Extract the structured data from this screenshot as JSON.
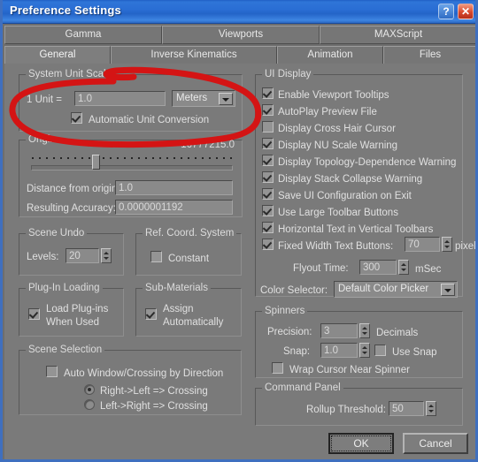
{
  "window": {
    "title": "Preference Settings",
    "help_button": "?",
    "close_button": "✕",
    "accent_titlebar": "#2a6ed4",
    "bg": "#7a7a7a",
    "annotation_color": "#d41414"
  },
  "tabs": {
    "top_row": [
      {
        "label": "Gamma",
        "active": false
      },
      {
        "label": "Viewports",
        "active": false
      },
      {
        "label": "MAXScript",
        "active": false
      }
    ],
    "bottom_row": [
      {
        "label": "General",
        "active": true
      },
      {
        "label": "Inverse Kinematics",
        "active": false
      },
      {
        "label": "Animation",
        "active": false
      },
      {
        "label": "Files",
        "active": false
      }
    ]
  },
  "system_unit_scale": {
    "group_title": "System Unit Scale",
    "unit_label": "1 Unit =",
    "unit_value": "1.0",
    "unit_type_selected": "Meters",
    "auto_conversion_label": "Automatic Unit Conversion",
    "auto_conversion_checked": true
  },
  "origin": {
    "group_title": "Origin",
    "max_value": "16777215.0",
    "distance_label": "Distance from origin:",
    "distance_value": "1.0",
    "accuracy_label": "Resulting Accuracy:",
    "accuracy_value": "0.0000001192"
  },
  "scene_undo": {
    "group_title": "Scene Undo",
    "levels_label": "Levels:",
    "levels_value": "20"
  },
  "ref_coord_system": {
    "group_title": "Ref. Coord. System",
    "constant_label": "Constant",
    "constant_checked": false
  },
  "plugin_loading": {
    "group_title": "Plug-In Loading",
    "load_label_line1": "Load Plug-ins",
    "load_label_line2": "When Used",
    "load_checked": true
  },
  "sub_materials": {
    "group_title": "Sub-Materials",
    "assign_label_line1": "Assign",
    "assign_label_line2": "Automatically",
    "assign_checked": true
  },
  "scene_selection": {
    "group_title": "Scene Selection",
    "auto_window_label": "Auto Window/Crossing by Direction",
    "auto_window_checked": false,
    "radio_right_left": "Right->Left => Crossing",
    "radio_left_right": "Left->Right => Crossing",
    "radio_selected": "right_left"
  },
  "ui_display": {
    "group_title": "UI Display",
    "checkboxes": [
      {
        "label": "Enable Viewport Tooltips",
        "checked": true
      },
      {
        "label": "AutoPlay Preview File",
        "checked": true
      },
      {
        "label": "Display Cross Hair Cursor",
        "checked": false
      },
      {
        "label": "Display NU Scale Warning",
        "checked": true
      },
      {
        "label": "Display Topology-Dependence Warning",
        "checked": true
      },
      {
        "label": "Display Stack Collapse Warning",
        "checked": true
      },
      {
        "label": "Save UI Configuration on Exit",
        "checked": true
      },
      {
        "label": "Use Large Toolbar Buttons",
        "checked": true
      },
      {
        "label": "Horizontal Text in Vertical Toolbars",
        "checked": true
      }
    ],
    "fixed_width_label": "Fixed Width Text Buttons:",
    "fixed_width_checked": true,
    "fixed_width_value": "70",
    "fixed_width_units": "pixels",
    "flyout_label": "Flyout Time:",
    "flyout_value": "300",
    "flyout_units": "mSec",
    "color_selector_label": "Color Selector:",
    "color_selector_value": "Default Color Picker"
  },
  "spinners": {
    "group_title": "Spinners",
    "precision_label": "Precision:",
    "precision_value": "3",
    "precision_units": "Decimals",
    "snap_label": "Snap:",
    "snap_value": "1.0",
    "use_snap_label": "Use Snap",
    "use_snap_checked": false,
    "wrap_label": "Wrap Cursor Near Spinner",
    "wrap_checked": false
  },
  "command_panel": {
    "group_title": "Command Panel",
    "rollup_label": "Rollup Threshold:",
    "rollup_value": "50"
  },
  "footer": {
    "ok_label": "OK",
    "cancel_label": "Cancel"
  }
}
